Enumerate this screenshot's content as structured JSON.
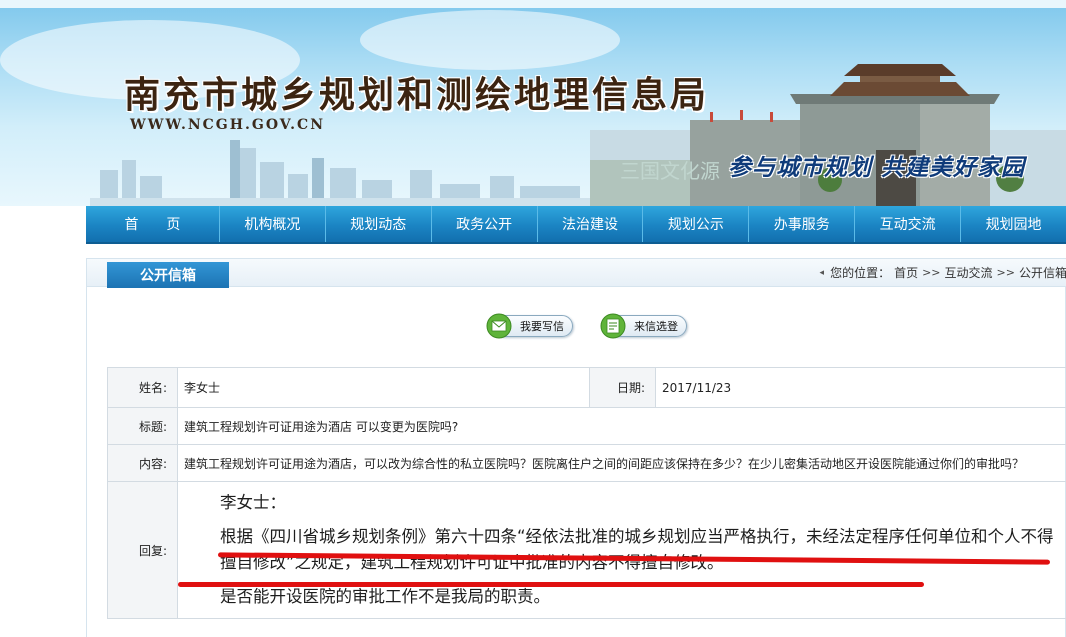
{
  "site": {
    "title": "南充市城乡规划和测绘地理信息局",
    "url": "WWW.NCGH.GOV.CN",
    "slogan": "参与城市规划 共建美好家园"
  },
  "nav": {
    "items": [
      "首页",
      "机构概况",
      "规划动态",
      "政务公开",
      "法治建设",
      "规划公示",
      "办事服务",
      "互动交流",
      "规划园地"
    ]
  },
  "section": {
    "tab_label": "公开信箱"
  },
  "breadcrumb": {
    "prefix": "您的位置：",
    "items": [
      "首页",
      "互动交流",
      "公开信箱"
    ],
    "separator": ">>"
  },
  "actions": {
    "write_letter": "我要写信",
    "letter_selection": "来信选登"
  },
  "letter": {
    "name_label": "姓名:",
    "name": "李女士",
    "date_label": "日期:",
    "date": "2017/11/23",
    "subject_label": "标题:",
    "subject": "建筑工程规划许可证用途为酒店 可以变更为医院吗?",
    "content_label": "内容:",
    "content": "建筑工程规划许可证用途为酒店，可以改为综合性的私立医院吗？医院离住户之间的间距应该保持在多少？在少儿密集活动地区开设医院能通过你们的审批吗？",
    "reply_label": "回复:",
    "reply_greeting": "李女士：",
    "reply_para1": "根据《四川省城乡规划条例》第六十四条“经依法批准的城乡规划应当严格执行，未经法定程序任何单位和个人不得擅自修改”之规定，建筑工程规划许可证中批准的内容不得擅自修改。",
    "reply_para2": "是否能开设医院的审批工作不是我局的职责。"
  },
  "colors": {
    "nav_blue": "#1b84c3",
    "tab_blue": "#1c73b3",
    "annotation_red": "#e01010",
    "title_brown": "#3c2411",
    "slogan_blue": "#0f3b7a"
  }
}
